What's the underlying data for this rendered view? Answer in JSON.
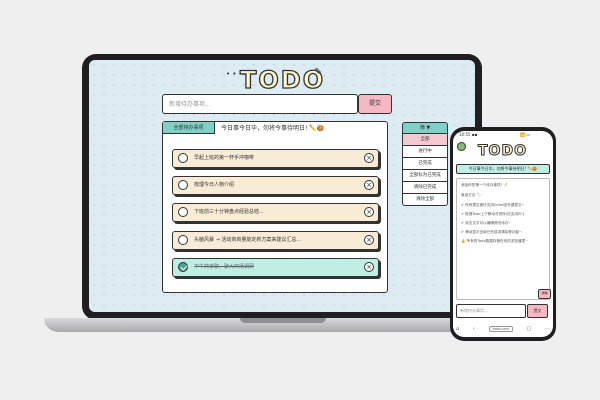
{
  "app": {
    "title": "TODO"
  },
  "input": {
    "placeholder": "新增待办事项...",
    "submit_label": "提交"
  },
  "tabs": {
    "active_label": "全部待办事项",
    "message": "今日事今日毕，勿将今事待明日! ✏️🍪"
  },
  "tasks": [
    {
      "text": "早起上班的第一杯手冲咖啡",
      "done": false
    },
    {
      "text": "梳理今日人物介绍",
      "done": false
    },
    {
      "text": "下班前三十分钟盘点经验总结...",
      "done": false
    },
    {
      "text": "头脑风暴 → 活动商商量敲定新方案来建议汇总...",
      "done": false
    },
    {
      "text": "下午商家聊，聊大商场调研",
      "done": true
    }
  ],
  "filter_menu": {
    "header": "筛 ▼",
    "items": [
      "全部",
      "进行中",
      "已完成",
      "全部标为已完成",
      "清除已完成",
      "清除全部"
    ],
    "selected_index": 0
  },
  "phone": {
    "status_left": "10:55 ▪▪",
    "status_right": "📶 ▭",
    "title": "TODO",
    "tab_message": "今日事今日毕，勿将今事待明日! ✏️🍪",
    "lines": [
      "添加你的第一个待办事项! 📝",
      "食用方法 🥄:",
      "✔ 所有提交操作支持Enter回车键提交~",
      "✔ 拖拽Todo上下移动可排序(仅支持PC)",
      "✔ 双击文字可以编辑修改待办~",
      "✔ 滑动显示全部已完成或清除等功能~",
      "🔒 所有的Todo数据存储在你的浏览器里~"
    ],
    "input_placeholder": "新增待办事项...",
    "send_label": "提交",
    "url": "todo.com",
    "corner_label": "清除"
  },
  "colors": {
    "accent_teal": "#7fd0c6",
    "accent_pink": "#f6b9c4",
    "task_bg": "#f8ecd6",
    "done_bg": "#bfeee3"
  }
}
